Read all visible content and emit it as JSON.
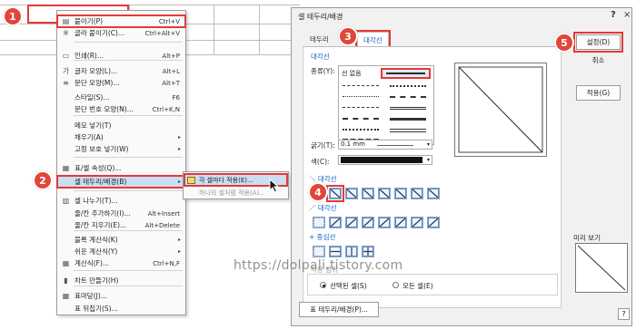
{
  "steps": [
    "1",
    "2",
    "3",
    "4",
    "5"
  ],
  "context_menu": {
    "items": [
      {
        "label": "붙이기(P)",
        "shortcut": "Ctrl+V",
        "icon": "paste-icon"
      },
      {
        "label": "골라 붙이기(C)...",
        "shortcut": "Ctrl+Alt+V",
        "icon": "paste-special-icon"
      },
      {
        "label": "인쇄(R)...",
        "shortcut": "Alt+P",
        "icon": "print-icon"
      },
      {
        "label": "글자 모양(L)...",
        "shortcut": "Alt+L",
        "icon": "font-icon"
      },
      {
        "label": "문단 모양(M)...",
        "shortcut": "Alt+T",
        "icon": "paragraph-icon"
      },
      {
        "label": "스타일(S)...",
        "shortcut": "F6",
        "icon": ""
      },
      {
        "label": "문단 번호 모양(N)...",
        "shortcut": "Ctrl+K,N",
        "icon": ""
      },
      {
        "label": "메모 넣기(T)",
        "shortcut": "",
        "icon": ""
      },
      {
        "label": "채우기(A)",
        "shortcut": "",
        "icon": "",
        "submenu": true
      },
      {
        "label": "고정 보호 넣기(W)",
        "shortcut": "",
        "icon": "",
        "submenu": true
      },
      {
        "label": "표/셀 속성(Q)...",
        "shortcut": "",
        "icon": "table-props-icon"
      },
      {
        "label": "셀 테두리/배경(B)",
        "shortcut": "",
        "icon": "",
        "submenu": true
      },
      {
        "label": "셀 나누기(T)...",
        "shortcut": "",
        "icon": "cell-split-icon"
      },
      {
        "label": "줄/칸 추가하기(I)...",
        "shortcut": "Alt+Insert",
        "icon": ""
      },
      {
        "label": "줄/칸 지우기(E)...",
        "shortcut": "Alt+Delete",
        "icon": ""
      },
      {
        "label": "블록 계산식(K)",
        "shortcut": "",
        "icon": "",
        "submenu": true
      },
      {
        "label": "쉬운 계산식(Y)",
        "shortcut": "",
        "icon": "",
        "submenu": true
      },
      {
        "label": "계산식(F)...",
        "shortcut": "Ctrl+N,F",
        "icon": "calc-icon"
      },
      {
        "label": "차트 만들기(H)",
        "shortcut": "",
        "icon": "chart-icon"
      },
      {
        "label": "표마당(J)...",
        "shortcut": "",
        "icon": "table-style-icon"
      },
      {
        "label": "표 뒤집기(S)...",
        "shortcut": "",
        "icon": ""
      }
    ]
  },
  "submenu": {
    "items": [
      {
        "label": "각 셀마다 적용(E)...",
        "icon": "cell-each-icon"
      },
      {
        "label": "하나의 셀처럼 적용(A)...",
        "icon": ""
      }
    ]
  },
  "dialog": {
    "title": "셀 테두리/배경",
    "help": "?",
    "close": "×",
    "tabs": [
      "테두리",
      "대각선"
    ],
    "section_diag": "대각선",
    "type_label": "종류(Y):",
    "type_selected": "선 없음",
    "thickness_label": "굵기(T):",
    "thickness_value": "0.1 mm",
    "color_label": "색(C):",
    "group_back_diag": "＼ 대각선",
    "group_fwd_diag": "／ 대각선",
    "group_center": "+ 중심선",
    "apply_group_label": "적용 범위",
    "apply_options": [
      "선택된 셀(S)",
      "모든 셀(E)"
    ],
    "bottom_button": "표 테두리/배경(P)...",
    "buttons": {
      "ok": "설정(D)",
      "cancel": "취소",
      "apply": "적용(G)"
    },
    "preview_label": "미리 보기",
    "help_box": "?"
  },
  "watermark": "https://dolpali.tistory.com",
  "colors": {
    "accent": "#e53935",
    "highlight": "#c9ddf3",
    "link": "#1565c0"
  }
}
